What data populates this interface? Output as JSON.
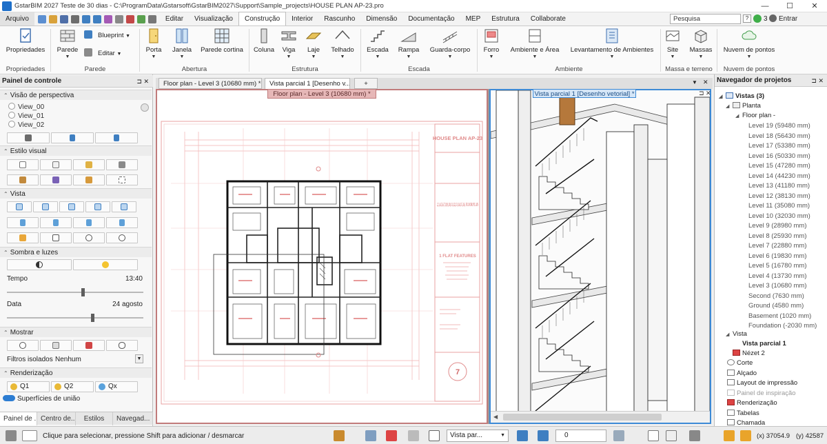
{
  "app": {
    "title": "GstarBIM  2027 Teste de 30 dias - C:\\ProgramData\\Gstarsoft\\GstarBIM2027\\Support\\Sample_projects\\HOUSE PLAN AP-23.pro",
    "window_controls": {
      "minimize": "—",
      "maximize": "☐",
      "close": "✕"
    }
  },
  "menu": {
    "file": "Arquivo",
    "tabs": [
      "Editar",
      "Visualização",
      "Construção",
      "Interior",
      "Rascunho",
      "Dimensão",
      "Documentação",
      "MEP",
      "Estrutura",
      "Collaborate"
    ],
    "active_tab": "Construção",
    "search_placeholder": "Pesquisa",
    "notif_count": "3",
    "login": "Entrar",
    "help": "?"
  },
  "ribbon": {
    "buttons": {
      "propriedades": "Propriedades",
      "parede": "Parede",
      "blueprint": "Blueprint",
      "editar": "Editar",
      "porta": "Porta",
      "janela": "Janela",
      "parede_cortina": "Parede cortina",
      "coluna": "Coluna",
      "viga": "Viga",
      "laje": "Laje",
      "telhado": "Telhado",
      "escada": "Escada",
      "rampa": "Rampa",
      "guarda_corpo": "Guarda-corpo",
      "forro": "Forro",
      "ambiente_area": "Ambiente e Área",
      "levantamento": "Levantamento de Ambientes",
      "site": "Site",
      "massas": "Massas",
      "nuvem": "Nuvem de pontos"
    },
    "groups": {
      "propriedades": "Propriedades",
      "parede": "Parede",
      "abertura": "Abertura",
      "estrutura": "Estrutura",
      "escada": "Escada",
      "ambiente": "Ambiente",
      "massa": "Massa e terreno",
      "nuvem": "Nuvem de pontos"
    }
  },
  "left_panel": {
    "title": "Painel de controle",
    "pin": "⊐ ✕",
    "sections": {
      "perspectiva": "Visão de perspectiva",
      "estilo": "Estilo visual",
      "vista": "Vista",
      "sombra": "Sombra e luzes",
      "mostrar": "Mostrar",
      "renderizacao": "Renderização"
    },
    "views": [
      "View_00",
      "View_01",
      "View_02"
    ],
    "tempo_label": "Tempo",
    "tempo_value": "13:40",
    "tempo_level": 0.56,
    "data_label": "Data",
    "data_value": "24 agosto",
    "data_level": 0.63,
    "filtros_label": "Filtros isolados",
    "filtros_value": "Nenhum",
    "render_buttons": [
      "Q1",
      "Q2",
      "Qx"
    ],
    "superficies": "Superfícies de união",
    "bottom_tabs": [
      "Painel de ...",
      "Centro de...",
      "Estilos",
      "Navegad..."
    ]
  },
  "doc_tabs": [
    "Floor plan - Level 3 (10680 mm) *",
    "Vista parcial 1 [Desenho v...",
    "+"
  ],
  "viewport1": {
    "label": "Floor plan - Level 3 (10680 mm) *",
    "sheet": {
      "title": "HOUSE PLAN AP-23",
      "floors": "2,3,4,5,6,7,8,9,10,11,12,13,14,15,16, FLOOR PLAN",
      "features": "1 FLAT FEATURES",
      "page": "7"
    }
  },
  "viewport2": {
    "label": "Vista parcial 1 [Desenho vetorial] *",
    "ctl": "⊐ ✕"
  },
  "right_panel": {
    "title": "Navegador de projetos",
    "root": "Vistas (3)",
    "planta": "Planta",
    "floorplan": "Floor plan -",
    "levels": [
      "Level 19 (59480 mm)",
      "Level 18 (56430 mm)",
      "Level 17 (53380 mm)",
      "Level 16 (50330 mm)",
      "Level 15 (47280 mm)",
      "Level 14 (44230 mm)",
      "Level 13 (41180 mm)",
      "Level 12 (38130 mm)",
      "Level 11 (35080 mm)",
      "Level 10 (32030 mm)",
      "Level 9 (28980 mm)",
      "Level 8 (25930 mm)",
      "Level 7 (22880 mm)",
      "Level 6 (19830 mm)",
      "Level 5 (16780 mm)",
      "Level 4 (13730 mm)",
      "Level 3 (10680 mm)",
      "Second (7630 mm)",
      "Ground (4580 mm)",
      "Basement (1020 mm)",
      "Foundation (-2030 mm)"
    ],
    "vista": "Vista",
    "vista_parcial": "Vista parcial 1",
    "nezet": "Nézet 2",
    "others": [
      "Corte",
      "Alçado",
      "Layout de impressão",
      "Painel de inspiração",
      "Renderização",
      "Tabelas",
      "Chamada"
    ]
  },
  "status": {
    "hint": "Clique para selecionar, pressione Shift para adicionar / desmarcar",
    "view_select": "Vista par...",
    "value": "0",
    "x": "(x) 37054.9",
    "y": "(y) 42587"
  },
  "colors": {
    "accent": "#1e6fc9",
    "plan_red": "#c17b7b",
    "vp2_blue": "#3d8ad6"
  }
}
